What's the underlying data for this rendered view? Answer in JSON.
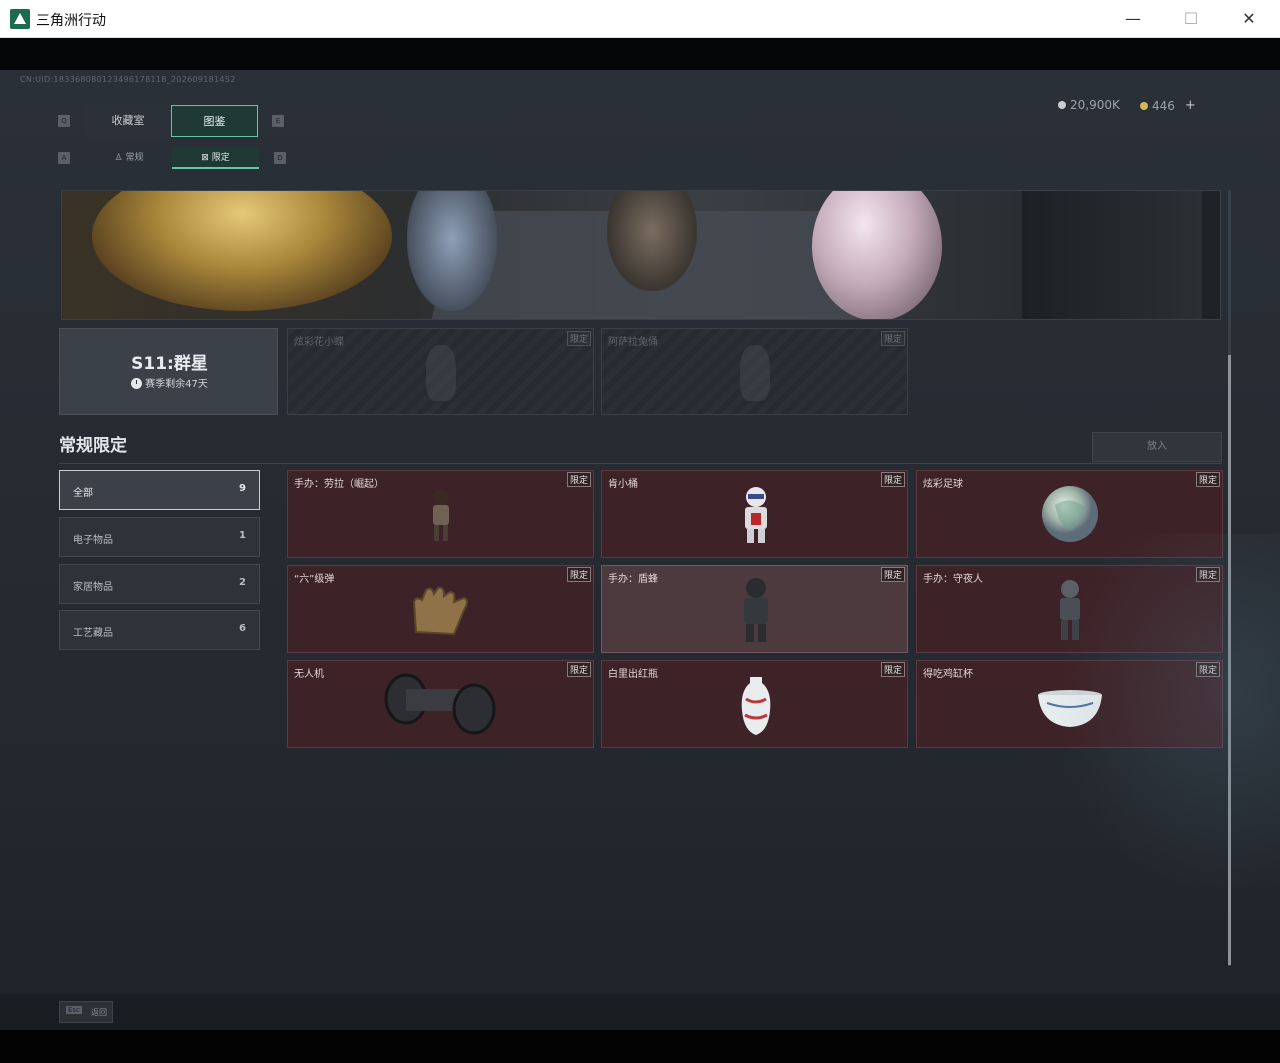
{
  "window": {
    "title": "三角洲行动",
    "min": "—",
    "max": "☐",
    "close": "✕"
  },
  "header": {
    "uid": "CN:UID:183368080123496178118_202609181452",
    "currency_silver": "20,900K",
    "currency_gold": "446",
    "add": "+"
  },
  "keys": {
    "q": "Q",
    "e": "E",
    "a": "A",
    "d": "D"
  },
  "tabs": [
    {
      "label": "收藏室",
      "active": false
    },
    {
      "label": "图鉴",
      "active": true
    }
  ],
  "subtabs": [
    {
      "label": "常规",
      "icon": "figure-icon",
      "active": false
    },
    {
      "label": "限定",
      "icon": "box-icon",
      "active": true
    }
  ],
  "season": {
    "title": "S11:群星",
    "remaining": "赛季剩余47天"
  },
  "locked": [
    {
      "name": "炫彩花小蝶",
      "badge": "限定"
    },
    {
      "name": "阿萨拉兔俑",
      "badge": "限定"
    }
  ],
  "section": {
    "title": "常规限定",
    "put_button": "放入"
  },
  "categories": [
    {
      "label": "全部",
      "count": "9",
      "active": true
    },
    {
      "label": "电子物品",
      "count": "1",
      "active": false
    },
    {
      "label": "家居物品",
      "count": "2",
      "active": false
    },
    {
      "label": "工艺藏品",
      "count": "6",
      "active": false
    }
  ],
  "items": [
    {
      "name": "手办：劳拉（崛起）",
      "badge": "限定",
      "icon": "figurine-icon"
    },
    {
      "name": "肯小桶",
      "badge": "限定",
      "icon": "bucket-figure-icon"
    },
    {
      "name": "炫彩足球",
      "badge": "限定",
      "icon": "football-icon"
    },
    {
      "name": "“六”级弹",
      "badge": "限定",
      "icon": "hand-icon"
    },
    {
      "name": "手办：盾蜂",
      "badge": "限定",
      "icon": "armored-figure-icon"
    },
    {
      "name": "手办：守夜人",
      "badge": "限定",
      "icon": "robot-figure-icon"
    },
    {
      "name": "无人机",
      "badge": "限定",
      "icon": "drone-icon"
    },
    {
      "name": "白里出红瓶",
      "badge": "限定",
      "icon": "vase-icon"
    },
    {
      "name": "得吃鸡缸杯",
      "badge": "限定",
      "icon": "bowl-icon"
    }
  ],
  "footer": {
    "esc_key": "Esc",
    "back": "返回"
  },
  "colors": {
    "accent": "#5fc9a4",
    "item_bg": "#3d2227",
    "bg": "#272c33"
  }
}
